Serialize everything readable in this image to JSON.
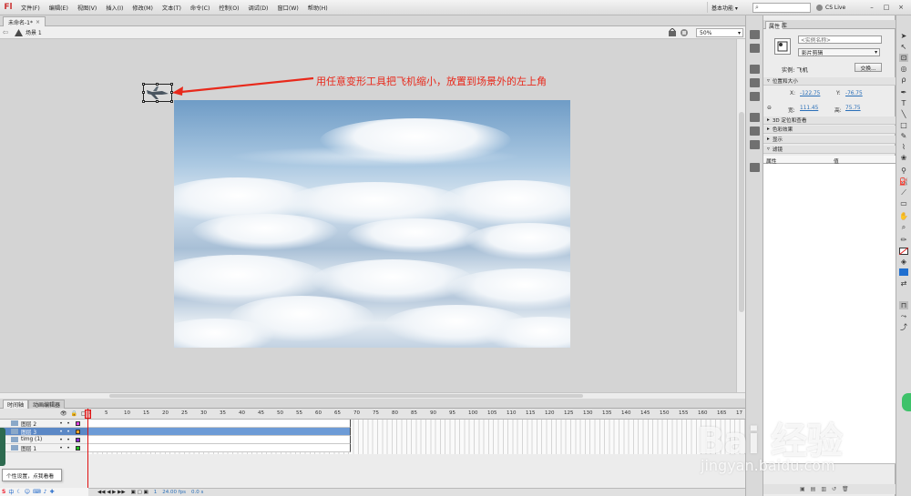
{
  "menu": {
    "logo": "Fl",
    "items": [
      "文件(F)",
      "编辑(E)",
      "视图(V)",
      "插入(I)",
      "修改(M)",
      "文本(T)",
      "命令(C)",
      "控制(O)",
      "调试(D)",
      "窗口(W)",
      "帮助(H)"
    ],
    "workspace": "基本功能 ▾",
    "search_icon": "search-icon",
    "cslive": "CS Live",
    "win_min": "–",
    "win_max": "□",
    "win_close": "×"
  },
  "document": {
    "tab_title": "未命名-1*",
    "tab_close": "×",
    "scene": "场景 1",
    "zoom": "50%"
  },
  "annotation": {
    "text": "用任意变形工具把飞机缩小，放置到场景外的左上角",
    "color": "#e8291b"
  },
  "timeline": {
    "tabs": [
      "时间轴",
      "动画编辑器"
    ],
    "frame_numbers": [
      "1",
      "5",
      "10",
      "15",
      "20",
      "25",
      "30",
      "35",
      "40",
      "45",
      "50",
      "55",
      "60",
      "65",
      "70",
      "75",
      "80",
      "85",
      "90",
      "95",
      "100",
      "105",
      "110",
      "115",
      "120",
      "125",
      "130",
      "135",
      "140",
      "145",
      "150",
      "155",
      "160",
      "165",
      "17"
    ],
    "layers": [
      {
        "name": "图层 2",
        "color": "#e040e0",
        "selected": false
      },
      {
        "name": "图层 3",
        "color": "#f0a020",
        "selected": true
      },
      {
        "name": "timg (1)",
        "color": "#8a2ad6",
        "selected": false
      },
      {
        "name": "图层 1",
        "color": "#21c021",
        "selected": false
      }
    ],
    "status": {
      "frame": "1",
      "fps": "24.00 fps",
      "time": "0.0 s"
    }
  },
  "properties": {
    "tabs": [
      "属性",
      "库"
    ],
    "instance_name_placeholder": "<实例名称>",
    "instance_type": "影片剪辑",
    "instance_label": "实例: 飞机",
    "swap_button": "交换...",
    "sections": {
      "position_size": "位置和大小",
      "transform3d": "3D 定位和查看",
      "color_effect": "色彩效果",
      "display": "显示",
      "filters": "滤镜"
    },
    "x_label": "X:",
    "x_value": "-122.75",
    "y_label": "Y:",
    "y_value": "-76.75",
    "w_label": "宽:",
    "w_value": "111.45",
    "h_label": "高:",
    "h_value": "75.75",
    "filter_columns": [
      "属性",
      "值"
    ]
  },
  "tooltip": "个性设置，点我看看",
  "ime": "中",
  "watermark": {
    "main": "Bai 经验",
    "sub": "jingyan.baidu.com"
  }
}
